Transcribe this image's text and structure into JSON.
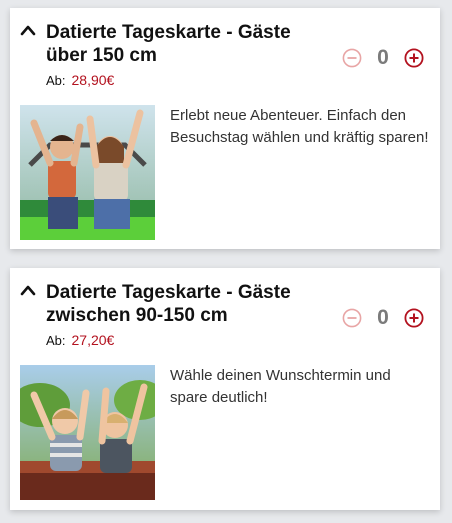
{
  "products": [
    {
      "title": "Datierte Tageskarte - Gäste über 150 cm",
      "price_prefix": "Ab:",
      "price": "28,90€",
      "quantity": "0",
      "description": "Erlebt neue Abenteuer. Einfach den Besuchstag wählen und kräftig sparen!",
      "image_icon": "rollercoaster-adults-photo"
    },
    {
      "title": "Datierte Tageskarte - Gäste zwischen 90-150 cm",
      "price_prefix": "Ab:",
      "price": "27,20€",
      "quantity": "0",
      "description": "Wähle deinen Wunschtermin und spare deutlich!",
      "image_icon": "rollercoaster-kids-photo"
    }
  ],
  "colors": {
    "price": "#b3121f",
    "minus_disabled": "#e8a5a5",
    "plus_active": "#b3121f",
    "quantity_text": "#7b7b7b"
  }
}
